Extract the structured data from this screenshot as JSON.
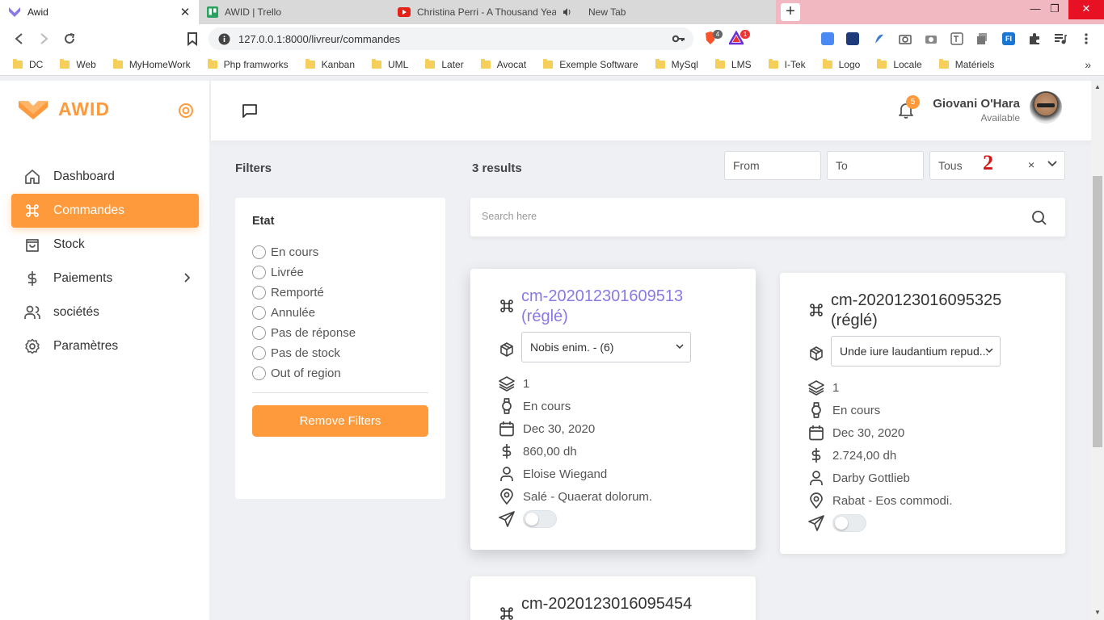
{
  "browser": {
    "tabs": [
      {
        "title": "Awid",
        "active": true
      },
      {
        "title": "AWID | Trello",
        "active": false
      },
      {
        "title": "Christina Perri - A Thousand Years",
        "active": false
      },
      {
        "title": "New Tab",
        "active": false
      }
    ],
    "url": "127.0.0.1:8000/livreur/commandes",
    "bookmarks": [
      "DC",
      "Web",
      "MyHomeWork",
      "Php framworks",
      "Kanban",
      "UML",
      "Later",
      "Avocat",
      "Exemple Software",
      "MySql",
      "LMS",
      "I-Tek",
      "Logo",
      "Locale",
      "Matériels"
    ],
    "brave_badge": "4",
    "alert_badge": "1",
    "more": "»"
  },
  "app": {
    "logo_text": "AWID",
    "nav": [
      {
        "label": "Dashboard",
        "icon": "home-icon"
      },
      {
        "label": "Commandes",
        "icon": "command-icon",
        "active": true
      },
      {
        "label": "Stock",
        "icon": "bag-icon"
      },
      {
        "label": "Paiements",
        "icon": "dollar-icon",
        "has_submenu": true
      },
      {
        "label": "sociétés",
        "icon": "users-icon"
      },
      {
        "label": "Paramètres",
        "icon": "settings-icon"
      }
    ],
    "header": {
      "notification_count": "5",
      "user_name": "Giovani O'Hara",
      "user_status": "Available"
    }
  },
  "filters": {
    "title": "Filters",
    "results": "3 results",
    "from_placeholder": "From",
    "to_placeholder": "To",
    "state_select": "Tous",
    "annotation": "2",
    "clear": "×",
    "etat_title": "Etat",
    "etat_options": [
      "En cours",
      "Livrée",
      "Remporté",
      "Annulée",
      "Pas de réponse",
      "Pas de stock",
      "Out of region"
    ],
    "remove_button": "Remove Filters",
    "search_placeholder": "Search here"
  },
  "orders": [
    {
      "code": "cm-202012301609513",
      "status": "(réglé)",
      "product": "Nobis enim. - (6)",
      "quantity": "1",
      "state": "En cours",
      "date": "Dec 30, 2020",
      "amount": "860,00 dh",
      "client": "Eloise Wiegand",
      "location": "Salé - Quaerat dolorum.",
      "sent": false
    },
    {
      "code": "cm-2020123016095325",
      "status": "(réglé)",
      "product": "Unde iure laudantium repud...",
      "quantity": "1",
      "state": "En cours",
      "date": "Dec 30, 2020",
      "amount": "2.724,00 dh",
      "client": "Darby Gottlieb",
      "location": "Rabat - Eos commodi.",
      "sent": false
    },
    {
      "code": "cm-2020123016095454"
    }
  ]
}
